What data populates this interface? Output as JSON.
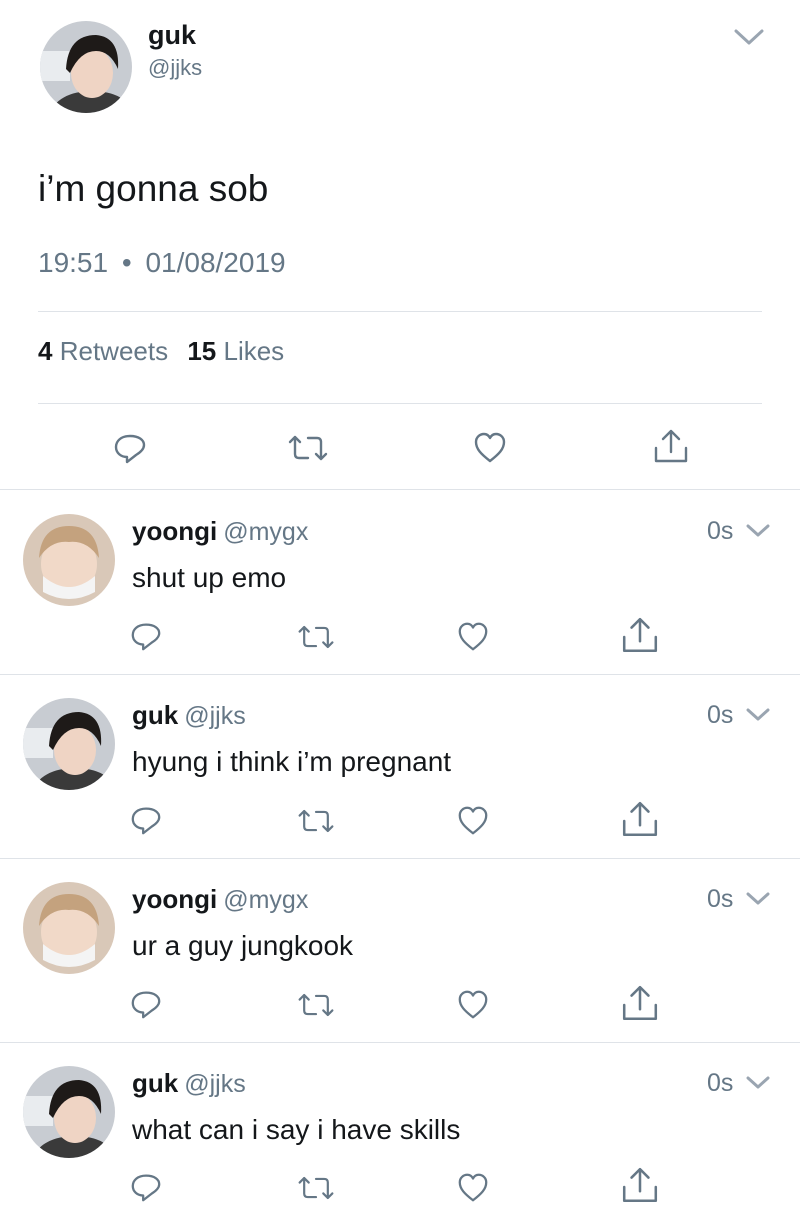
{
  "main_tweet": {
    "name": "guk",
    "handle": "@jjks",
    "text": "i’m gonna sob",
    "time": "19:51",
    "separator": "•",
    "date": "01/08/2019",
    "retweets_count": "4",
    "retweets_label": "Retweets",
    "likes_count": "15",
    "likes_label": "Likes"
  },
  "replies": [
    {
      "name": "yoongi",
      "handle": "@mygx",
      "time": "0s",
      "text": "shut up emo"
    },
    {
      "name": "guk",
      "handle": "@jjks",
      "time": "0s",
      "text": "hyung i think i’m pregnant"
    },
    {
      "name": "yoongi",
      "handle": "@mygx",
      "time": "0s",
      "text": "ur a guy jungkook"
    },
    {
      "name": "guk",
      "handle": "@jjks",
      "time": "0s",
      "text": "what can i say i have skills"
    }
  ],
  "icons": [
    "reply-icon",
    "retweet-icon",
    "like-icon",
    "share-icon",
    "chevron-down-icon",
    "avatar"
  ],
  "colors": {
    "text": "#14171a",
    "secondary": "#657786",
    "divider": "#dfe3e8",
    "background": "#ffffff"
  }
}
